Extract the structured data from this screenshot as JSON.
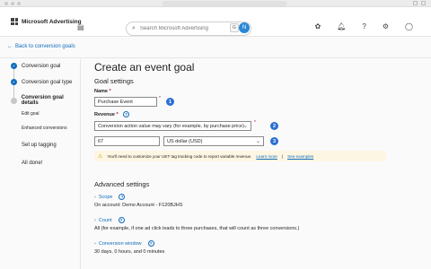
{
  "app": {
    "logo_text": "Microsoft Advertising",
    "search_placeholder": "Search Microsoft Advertising",
    "kbd_hint": [
      "G",
      "/"
    ],
    "avatar": "N",
    "icons": [
      "sidebar-toggle-icon",
      "copilot-icon",
      "bell-icon",
      "help-icon",
      "gear-icon",
      "account-icon"
    ]
  },
  "nav": {
    "back_label": "Back to conversion goals"
  },
  "steps": [
    {
      "label": "Conversion goal",
      "state": "done"
    },
    {
      "label": "Conversion goal type",
      "state": "done"
    },
    {
      "label": "Conversion goal details",
      "state": "current"
    },
    {
      "label": "Set up tagging",
      "state": "todo"
    },
    {
      "label": "All done!",
      "state": "todo"
    }
  ],
  "substeps": [
    "Edit goal",
    "Enhanced conversions"
  ],
  "page": {
    "title": "Create an event goal",
    "goal_settings_heading": "Goal settings",
    "name_label": "Name",
    "name_required": "*",
    "name_value": "Purchase Event",
    "revenue_label": "Revenue",
    "revenue_required": "*",
    "revenue_option": "Conversion action value may vary (for example, by purchase price)",
    "revenue_value": "67",
    "currency": "US dollar (USD)",
    "badges": [
      "1",
      "2",
      "3"
    ],
    "warning": {
      "text": "You'll need to customize your UET tag tracking code to report variable revenue.",
      "learn_more": "Learn more",
      "separator": " | ",
      "see_examples": "See examples"
    },
    "advanced_heading": "Advanced settings",
    "scope_label": "Scope",
    "scope_value": "On account: Demo Account - F120BJHS",
    "count_label": "Count",
    "count_value": "All (for example, if one ad click leads to three purchases, that will count as three conversions.)",
    "window_label": "Conversion window",
    "window_value": "30 days, 0 hours, and 0 minutes"
  },
  "colors": {
    "accent": "#0f6cbd",
    "badge": "#2b6fd1",
    "warning_bg": "#fdf6e3"
  }
}
